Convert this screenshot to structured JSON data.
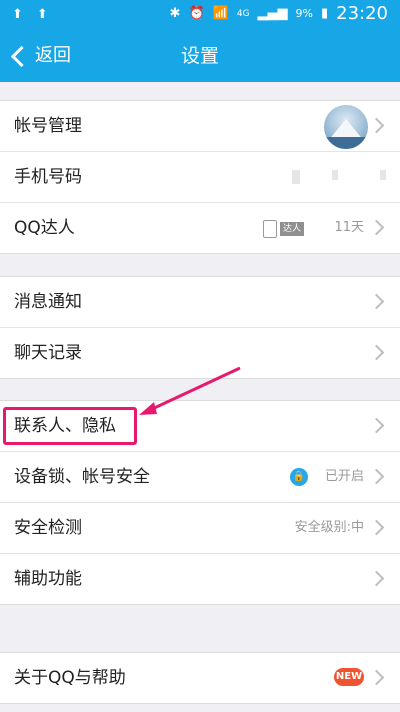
{
  "status_bar": {
    "network": "4G",
    "battery": "9%",
    "time": "23:20"
  },
  "title_bar": {
    "back_label": "返回",
    "title": "设置"
  },
  "group1": {
    "account": "帐号管理",
    "phone": "手机号码",
    "qq_daren": "QQ达人",
    "qq_daren_tag": "达人",
    "qq_daren_days": "11天"
  },
  "group2": {
    "notifications": "消息通知",
    "chat_history": "聊天记录"
  },
  "group3": {
    "contacts_privacy": "联系人、隐私",
    "device_lock": "设备锁、帐号安全",
    "device_lock_status": "已开启",
    "security_check": "安全检测",
    "security_level": "安全级别:中",
    "accessibility": "辅助功能"
  },
  "group4": {
    "about": "关于QQ与帮助",
    "about_badge": "NEW"
  },
  "colors": {
    "header": "#17a6e6",
    "highlight": "#e8186d"
  }
}
